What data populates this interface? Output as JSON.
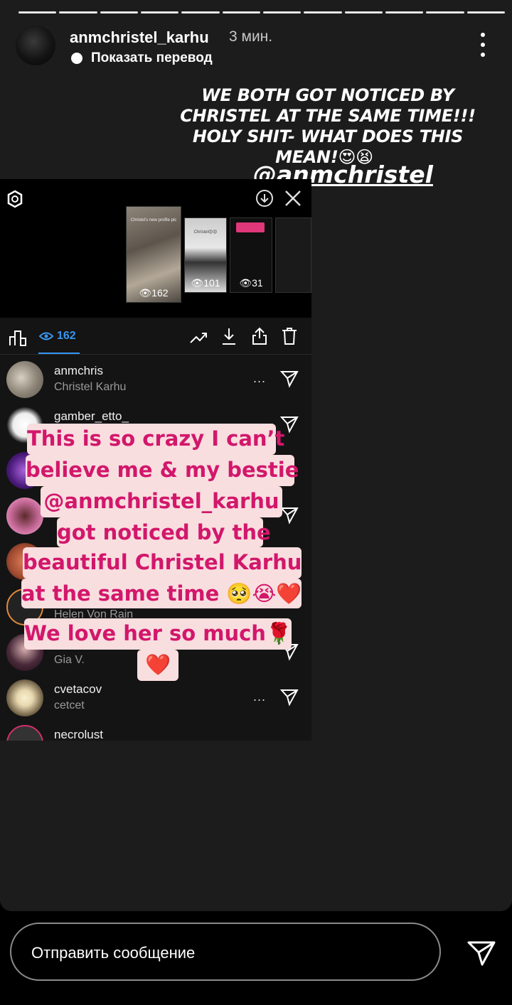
{
  "header": {
    "username": "anmchristel_karhu",
    "time": "3 мин.",
    "translate_label": "Показать перевод"
  },
  "story_caption": {
    "line1": "WE BOTH GOT NOTICED BY",
    "line2": "CHRISTEL AT THE SAME TIME!!!",
    "line3": "HOLY SHIT- WHAT DOES THIS",
    "line4": "MEAN!😍😫",
    "mention": "@anmchristel"
  },
  "embedded_screenshot": {
    "thumb_counts": [
      "162",
      "101",
      "31"
    ],
    "thumb_captions": [
      "Christel's new profile pic",
      "Christel😍😍"
    ],
    "views": "162",
    "viewers": [
      {
        "username": "anmchris",
        "name": "Christel Karhu"
      },
      {
        "username": "gamber_etto_",
        "name": ""
      },
      {
        "username": "",
        "name": ""
      },
      {
        "username": "",
        "name": ""
      },
      {
        "username": "",
        "name": ""
      },
      {
        "username": "",
        "name": "Helen Von Rain"
      },
      {
        "username": "",
        "name": "Gia V."
      },
      {
        "username": "cvetacov",
        "name": "cetcet"
      },
      {
        "username": "necrolust",
        "name": ""
      }
    ],
    "more_label": "..."
  },
  "sticker_text": {
    "line1": "This is so crazy I can’t",
    "line2": "believe me & my bestie",
    "line3": "@anmchristel_karhu",
    "line4": "got noticed by the",
    "line5": "beautiful Christel Karhu",
    "line6": "at the same time 🥺😭❤️",
    "line7": "We love her so much🌹",
    "line8": "❤️"
  },
  "reply": {
    "placeholder": "Отправить сообщение"
  },
  "colors": {
    "sticker_bg": "#f9dedf",
    "sticker_text": "#d2176b",
    "accent": "#3897f0"
  },
  "icons": [
    "more-vertical-icon",
    "settings-icon",
    "download-circle-icon",
    "close-icon",
    "insights-icon",
    "eye-icon",
    "promote-icon",
    "download-icon",
    "share-icon",
    "trash-icon",
    "send-icon"
  ]
}
